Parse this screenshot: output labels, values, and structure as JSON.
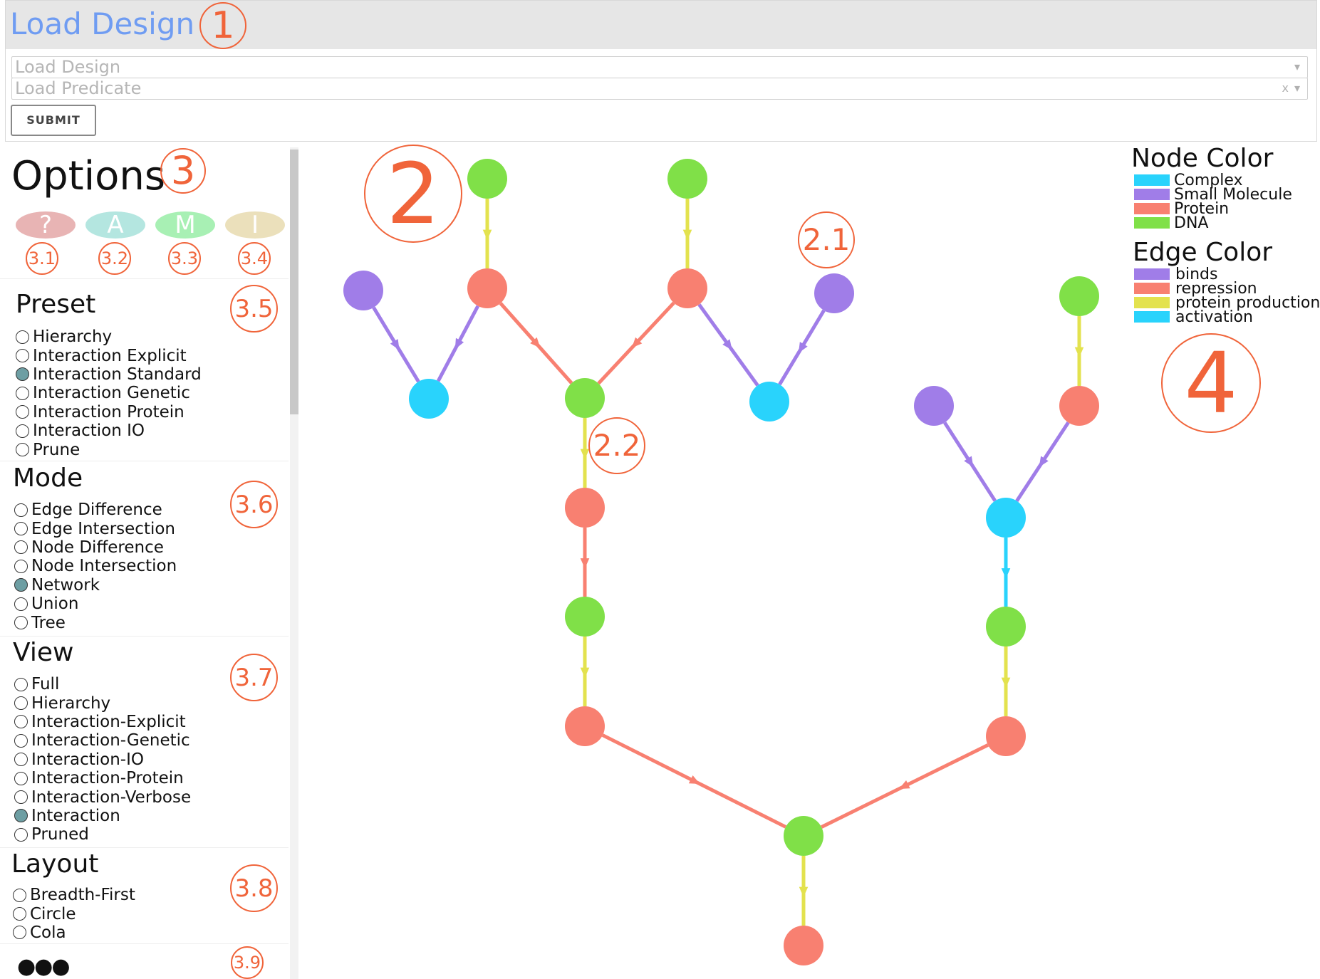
{
  "top": {
    "title": "Load Design",
    "design_placeholder": "Load Design",
    "predicate_placeholder": "Load Predicate",
    "clear_symbol": "x",
    "dropdown_symbol": "▾",
    "submit_label": "SUBMIT"
  },
  "callouts": {
    "c1": "1",
    "c2": "2",
    "c2_1": "2.1",
    "c2_2": "2.2",
    "c3": "3",
    "c3_1": "3.1",
    "c3_2": "3.2",
    "c3_3": "3.3",
    "c3_4": "3.4",
    "c3_5": "3.5",
    "c3_6": "3.6",
    "c3_7": "3.7",
    "c3_8": "3.8",
    "c3_9": "3.9",
    "c4": "4"
  },
  "options": {
    "title": "Options",
    "buttons": [
      {
        "label": "?",
        "color": "#e8b4b4"
      },
      {
        "label": "A",
        "color": "#b4e6e0"
      },
      {
        "label": "M",
        "color": "#a8f0b4"
      },
      {
        "label": "I",
        "color": "#ebe0bb"
      }
    ],
    "preset": {
      "title": "Preset",
      "items": [
        "Hierarchy",
        "Interaction Explicit",
        "Interaction Standard",
        "Interaction Genetic",
        "Interaction Protein",
        "Interaction IO",
        "Prune"
      ],
      "selected": "Interaction Standard"
    },
    "mode": {
      "title": "Mode",
      "items": [
        "Edge Difference",
        "Edge Intersection",
        "Node Difference",
        "Node Intersection",
        "Network",
        "Union",
        "Tree"
      ],
      "selected": "Network"
    },
    "view": {
      "title": "View",
      "items": [
        "Full",
        "Hierarchy",
        "Interaction-Explicit",
        "Interaction-Genetic",
        "Interaction-IO",
        "Interaction-Protein",
        "Interaction-Verbose",
        "Interaction",
        "Pruned"
      ],
      "selected": "Interaction"
    },
    "layout": {
      "title": "Layout",
      "items": [
        "Breadth-First",
        "Circle",
        "Cola"
      ],
      "selected": null
    },
    "more": "●●●"
  },
  "legend": {
    "node_title": "Node Color",
    "node_items": [
      {
        "label": "Complex",
        "color": "#29d3fc"
      },
      {
        "label": "Small Molecule",
        "color": "#a07de8"
      },
      {
        "label": "Protein",
        "color": "#f88071"
      },
      {
        "label": "DNA",
        "color": "#80e048"
      }
    ],
    "edge_title": "Edge Color",
    "edge_items": [
      {
        "label": "binds",
        "color": "#a07de8"
      },
      {
        "label": "repression",
        "color": "#f88071"
      },
      {
        "label": "protein production",
        "color": "#e3e24e"
      },
      {
        "label": "activation",
        "color": "#29d3fc"
      }
    ]
  },
  "graph": {
    "node_type_colors": {
      "complex": "#29d3fc",
      "small_molecule": "#a07de8",
      "protein": "#f88071",
      "dna": "#80e048"
    },
    "edge_type_colors": {
      "binds": "#a07de8",
      "repression": "#f88071",
      "production": "#e3e24e",
      "activation": "#29d3fc"
    },
    "nodes": [
      {
        "id": "dna1",
        "type": "dna"
      },
      {
        "id": "dna2",
        "type": "dna"
      },
      {
        "id": "sm1",
        "type": "small_molecule"
      },
      {
        "id": "p1",
        "type": "protein"
      },
      {
        "id": "p2",
        "type": "protein"
      },
      {
        "id": "sm2",
        "type": "small_molecule"
      },
      {
        "id": "c1",
        "type": "complex"
      },
      {
        "id": "dna3",
        "type": "dna"
      },
      {
        "id": "c2",
        "type": "complex"
      },
      {
        "id": "p3",
        "type": "protein"
      },
      {
        "id": "dna4",
        "type": "dna"
      },
      {
        "id": "p4",
        "type": "protein"
      },
      {
        "id": "dna5",
        "type": "dna"
      },
      {
        "id": "p5",
        "type": "protein"
      },
      {
        "id": "sm3",
        "type": "small_molecule"
      },
      {
        "id": "p6",
        "type": "protein"
      },
      {
        "id": "c3",
        "type": "complex"
      },
      {
        "id": "dna6",
        "type": "dna"
      },
      {
        "id": "p7",
        "type": "protein"
      },
      {
        "id": "dna7",
        "type": "dna"
      }
    ],
    "edges": [
      {
        "from": "dna1",
        "to": "p1",
        "type": "production"
      },
      {
        "from": "dna2",
        "to": "p2",
        "type": "production"
      },
      {
        "from": "sm1",
        "to": "c1",
        "type": "binds"
      },
      {
        "from": "p1",
        "to": "c1",
        "type": "binds"
      },
      {
        "from": "p1",
        "to": "dna3",
        "type": "repression"
      },
      {
        "from": "p2",
        "to": "dna3",
        "type": "repression"
      },
      {
        "from": "p2",
        "to": "c2",
        "type": "binds"
      },
      {
        "from": "sm2",
        "to": "c2",
        "type": "binds"
      },
      {
        "from": "dna3",
        "to": "p3",
        "type": "production"
      },
      {
        "from": "p3",
        "to": "dna4",
        "type": "repression"
      },
      {
        "from": "dna4",
        "to": "p4",
        "type": "production"
      },
      {
        "from": "p4",
        "to": "dna5",
        "type": "repression"
      },
      {
        "from": "dna5",
        "to": "p5",
        "type": "production"
      },
      {
        "from": "dna6",
        "to": "p6",
        "type": "production"
      },
      {
        "from": "sm3",
        "to": "c3",
        "type": "binds"
      },
      {
        "from": "p6",
        "to": "c3",
        "type": "binds"
      },
      {
        "from": "c3",
        "to": "dna7",
        "type": "activation"
      },
      {
        "from": "dna7",
        "to": "p7",
        "type": "production"
      },
      {
        "from": "p7",
        "to": "dna5",
        "type": "repression"
      }
    ]
  }
}
